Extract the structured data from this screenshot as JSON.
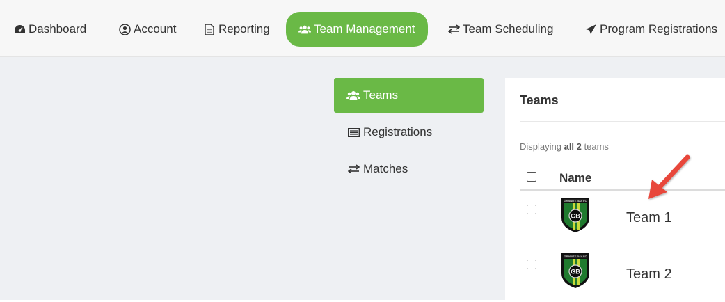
{
  "topnav": {
    "items": [
      {
        "label": "Dashboard",
        "icon": "dashboard-icon"
      },
      {
        "label": "Account",
        "icon": "user-circle-icon"
      },
      {
        "label": "Reporting",
        "icon": "file-text-icon"
      },
      {
        "label": "Team Management",
        "icon": "users-icon",
        "active": true
      },
      {
        "label": "Team Scheduling",
        "icon": "exchange-icon"
      },
      {
        "label": "Program Registrations",
        "icon": "paper-plane-icon"
      }
    ]
  },
  "subnav": {
    "items": [
      {
        "label": "Teams",
        "icon": "users-icon",
        "active": true
      },
      {
        "label": "Registrations",
        "icon": "list-icon"
      },
      {
        "label": "Matches",
        "icon": "exchange-icon"
      }
    ]
  },
  "panel": {
    "title": "Teams",
    "summary_prefix": "Displaying ",
    "summary_bold": "all 2",
    "summary_suffix": " teams",
    "column_name": "Name",
    "rows": [
      {
        "name": "Team 1",
        "crest_text": "GRANITE BAY FC"
      },
      {
        "name": "Team 2",
        "crest_text": "GRANITE BAY FC"
      }
    ]
  },
  "colors": {
    "accent": "#6ab946",
    "annotation_arrow": "#e8463a"
  }
}
